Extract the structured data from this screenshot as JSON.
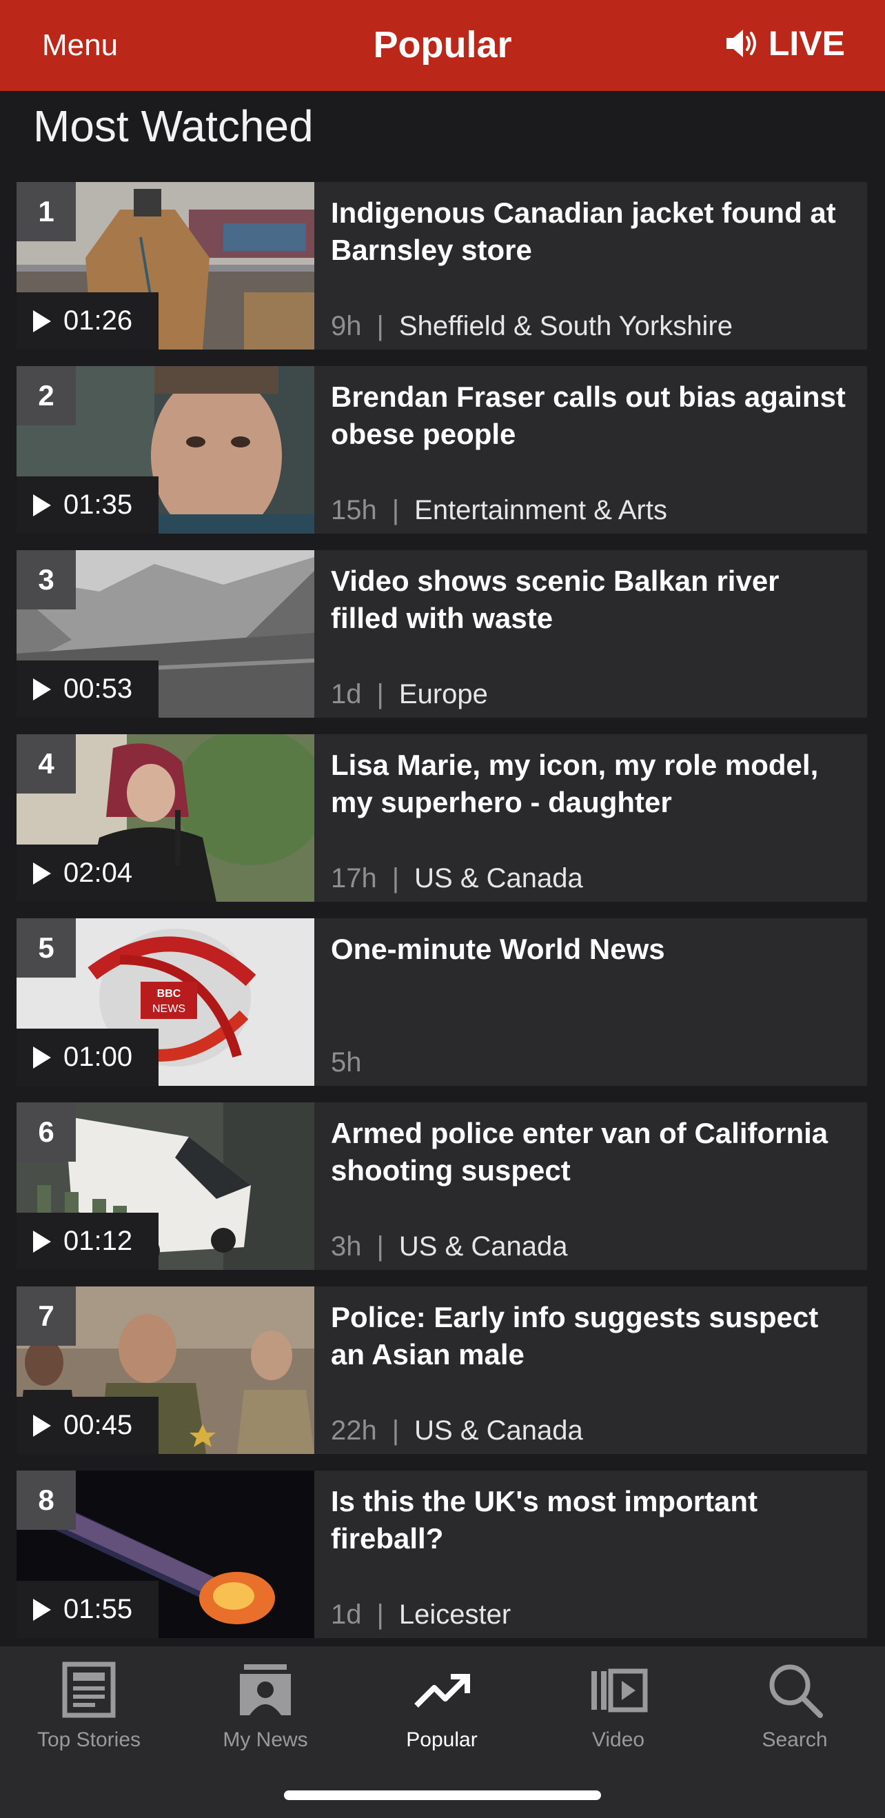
{
  "header": {
    "menu_label": "Menu",
    "title": "Popular",
    "live_label": "LIVE",
    "background": "#bb2718"
  },
  "section": {
    "title": "Most Watched"
  },
  "items": [
    {
      "rank": "1",
      "duration": "01:26",
      "headline": "Indigenous Canadian jacket found at Barnsley store",
      "age": "9h",
      "topic": "Sheffield & South Yorkshire"
    },
    {
      "rank": "2",
      "duration": "01:35",
      "headline": "Brendan Fraser calls out bias against obese people",
      "age": "15h",
      "topic": "Entertainment & Arts"
    },
    {
      "rank": "3",
      "duration": "00:53",
      "headline": "Video shows scenic Balkan river filled with waste",
      "age": "1d",
      "topic": "Europe"
    },
    {
      "rank": "4",
      "duration": "02:04",
      "headline": "Lisa Marie, my icon, my role model, my superhero - daughter",
      "age": "17h",
      "topic": "US & Canada"
    },
    {
      "rank": "5",
      "duration": "01:00",
      "headline": "One-minute World News",
      "age": "5h",
      "topic": "",
      "thumb_text_1": "BBC",
      "thumb_text_2": "NEWS"
    },
    {
      "rank": "6",
      "duration": "01:12",
      "headline": "Armed police enter van of California shooting suspect",
      "age": "3h",
      "topic": "US & Canada"
    },
    {
      "rank": "7",
      "duration": "00:45",
      "headline": "Police: Early info suggests suspect an Asian male",
      "age": "22h",
      "topic": "US & Canada"
    },
    {
      "rank": "8",
      "duration": "01:55",
      "headline": "Is this the UK's most important fireball?",
      "age": "1d",
      "topic": "Leicester"
    }
  ],
  "tabbar": {
    "tabs": [
      {
        "label": "Top Stories",
        "icon": "newspaper-icon"
      },
      {
        "label": "My News",
        "icon": "person-news-icon"
      },
      {
        "label": "Popular",
        "icon": "trending-icon",
        "active": true
      },
      {
        "label": "Video",
        "icon": "video-icon"
      },
      {
        "label": "Search",
        "icon": "search-icon"
      }
    ]
  }
}
